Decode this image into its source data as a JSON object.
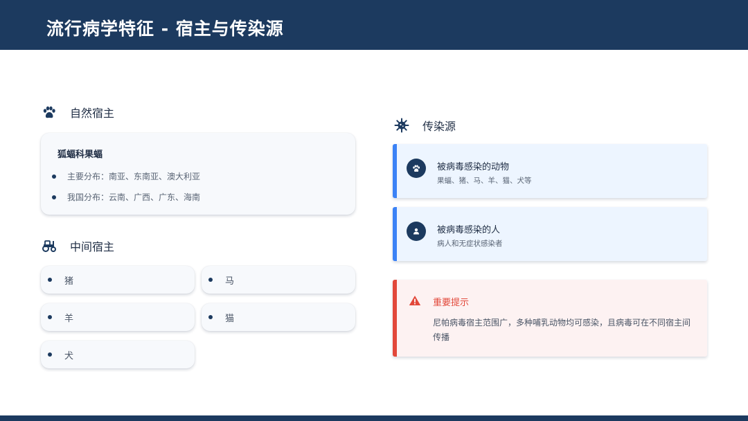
{
  "header": {
    "title": "流行病学特征 - 宿主与传染源"
  },
  "natural_host": {
    "label": "自然宿主",
    "icon": "paw-icon",
    "card": {
      "title": "狐蝠科果蝠",
      "items": [
        "主要分布：南亚、东南亚、澳大利亚",
        "我国分布：云南、广西、广东、海南"
      ]
    }
  },
  "intermediate_host": {
    "label": "中间宿主",
    "icon": "tractor-icon",
    "items": [
      "猪",
      "马",
      "羊",
      "猫",
      "犬"
    ]
  },
  "infection_source": {
    "label": "传染源",
    "icon": "virus-icon",
    "cards": [
      {
        "title": "被病毒感染的动物",
        "subtitle": "果蝠、猪、马、羊、猫、犬等",
        "icon": "paw-icon"
      },
      {
        "title": "被病毒感染的人",
        "subtitle": "病人和无症状感染者",
        "icon": "user-icon"
      }
    ]
  },
  "alert": {
    "title": "重要提示",
    "text": "尼帕病毒宿主范围广，多种哺乳动物均可感染，且病毒可在不同宿主间传播",
    "icon": "warning-icon"
  },
  "colors": {
    "navy": "#1c3a5f",
    "blue_accent": "#3b82f6",
    "red_accent": "#e2483a"
  }
}
